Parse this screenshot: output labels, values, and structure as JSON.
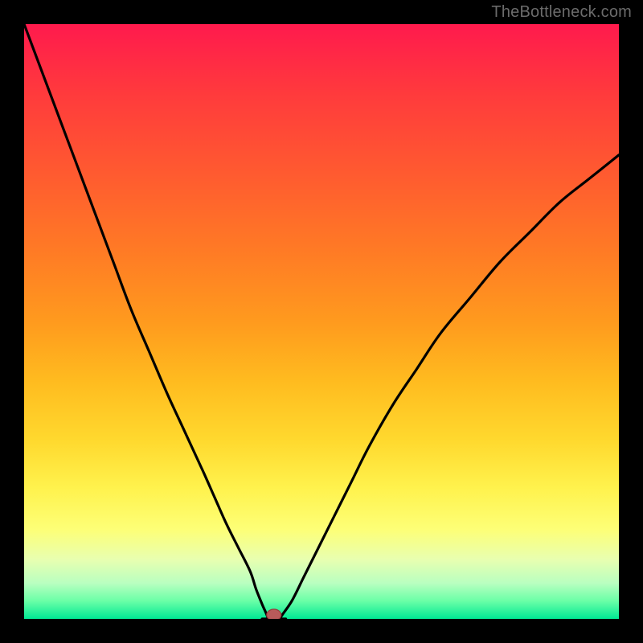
{
  "watermark": "TheBottleneck.com",
  "colors": {
    "frame": "#000000",
    "curve_stroke": "#000000",
    "marker_fill": "#b85a5a",
    "marker_stroke": "#9a3d3d",
    "gradient_top": "#ff1a4d",
    "gradient_bottom": "#00e994"
  },
  "chart_data": {
    "type": "line",
    "title": "",
    "xlabel": "",
    "ylabel": "",
    "xlim": [
      0,
      100
    ],
    "ylim": [
      0,
      100
    ],
    "grid": false,
    "legend": false,
    "marker": {
      "x": 42,
      "y": 0
    },
    "series": [
      {
        "name": "left-branch",
        "x": [
          0,
          3,
          6,
          9,
          12,
          15,
          18,
          21,
          24,
          27,
          30,
          32,
          34,
          36,
          38,
          39,
          40,
          41
        ],
        "y": [
          100,
          92,
          84,
          76,
          68,
          60,
          52,
          45,
          38,
          31.5,
          25,
          20.5,
          16,
          12,
          8,
          5,
          2.5,
          0
        ]
      },
      {
        "name": "valley-floor",
        "x": [
          40,
          41,
          42,
          43,
          44
        ],
        "y": [
          0,
          0,
          0,
          0,
          0
        ]
      },
      {
        "name": "right-branch",
        "x": [
          43,
          45,
          47,
          49,
          52,
          55,
          58,
          62,
          66,
          70,
          75,
          80,
          85,
          90,
          95,
          100
        ],
        "y": [
          0,
          3,
          7,
          11,
          17,
          23,
          29,
          36,
          42,
          48,
          54,
          60,
          65,
          70,
          74,
          78
        ]
      }
    ]
  }
}
